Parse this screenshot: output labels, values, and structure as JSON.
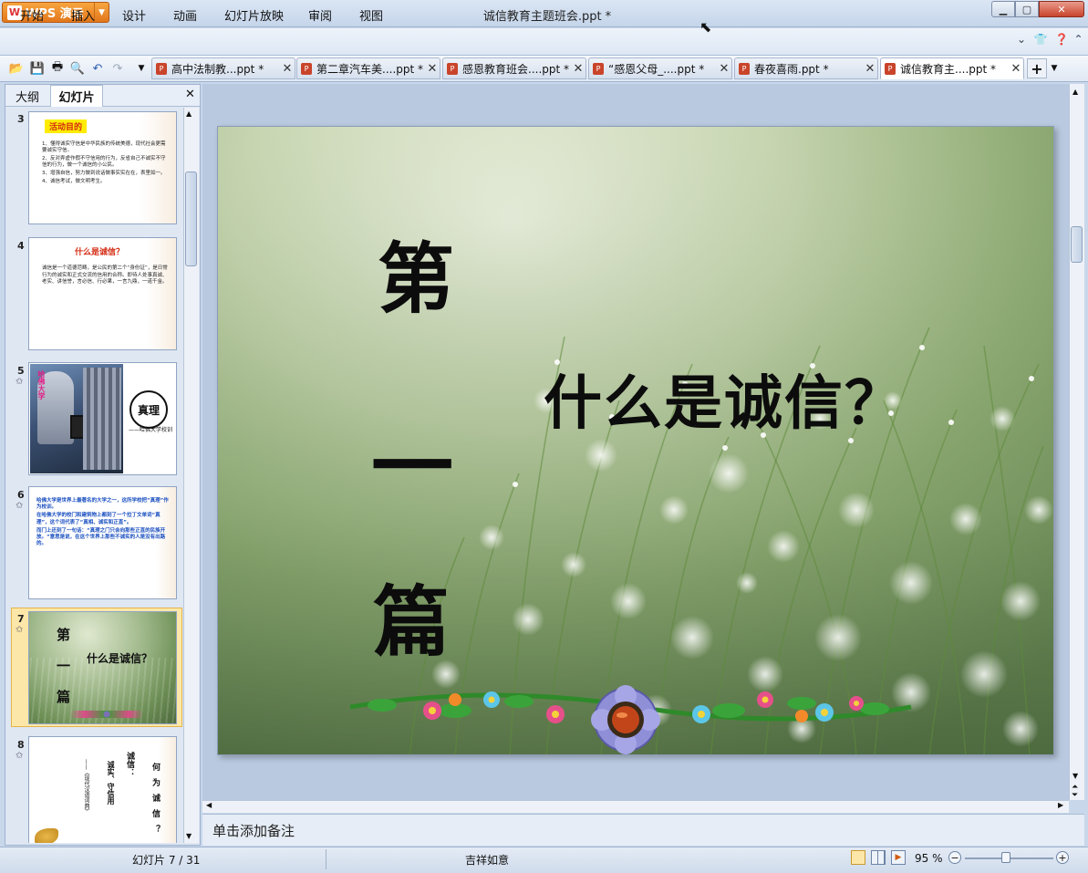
{
  "app": {
    "name": "WPS 演示",
    "doc_title": "诚信教育主题班会.ppt *"
  },
  "menu": [
    "开始",
    "插入",
    "设计",
    "动画",
    "幻灯片放映",
    "审阅",
    "视图"
  ],
  "tabs": [
    {
      "label": "高中法制教...ppt *"
    },
    {
      "label": "第二章汽车美....ppt *"
    },
    {
      "label": "感恩教育班会....ppt *"
    },
    {
      "label": "“感恩父母_....ppt *"
    },
    {
      "label": "春夜喜雨.ppt *"
    },
    {
      "label": "诚信教育主....ppt *"
    }
  ],
  "pane": {
    "outline": "大纲",
    "slides": "幻灯片"
  },
  "thumbs": [
    {
      "num": "3",
      "title": "活动目的",
      "lines": [
        "1、懂得诚实守信是中华民族的传统美德，现代社会更需要诚实守信。",
        "2、反对弄虚作假不守信用的行为，反省自己不诚实不守信的行为，做一个诚信的小公民。",
        "3、增强自信，努力做到说话做事实实在在，表里如一。",
        "4、诚信考试，做文明考生。"
      ]
    },
    {
      "num": "4",
      "title": "什么是诚信？",
      "body": "诚信是一个道德范畴，是公民的第二个“身份证”，是日常行为的诚实和正式交流的信用的合称。即待人处事真诚、老实、讲信誉，言必信、行必果，一言九鼎，一诺千金。"
    },
    {
      "num": "5",
      "side": "哈佛大学",
      "badge": "真理",
      "caption": "——哈佛大学校训"
    },
    {
      "num": "6",
      "p1": "哈佛大学是世界上最著名的大学之一，这所学校把“真理”作为校训。",
      "p2": "在哈佛大学的校门和建筑物上都刻了一个拉丁文单词“真理”，这个词代表了“真相、诚实和正直”。",
      "p3": "而门上还刻了一句话：“真理之门只会向那些正直的民族开放。”意思是说，在这个世界上那些不诚实的人是没有出路的。"
    },
    {
      "num": "7",
      "a": "第",
      "b": "一",
      "c": "篇",
      "q": "什么是诚信？"
    },
    {
      "num": "8",
      "c1": "何为诚信？",
      "c2": "诚信：",
      "c3": "诚实、守信用",
      "c4": "——《现代汉语词典》"
    }
  ],
  "slide": {
    "line1": "第",
    "line2": "一",
    "line3": "篇",
    "question": "什么是诚信？"
  },
  "notes": "单击添加备注",
  "status": {
    "slide": "幻灯片 7 / 31",
    "theme": "吉祥如意",
    "zoom": "95 %"
  }
}
